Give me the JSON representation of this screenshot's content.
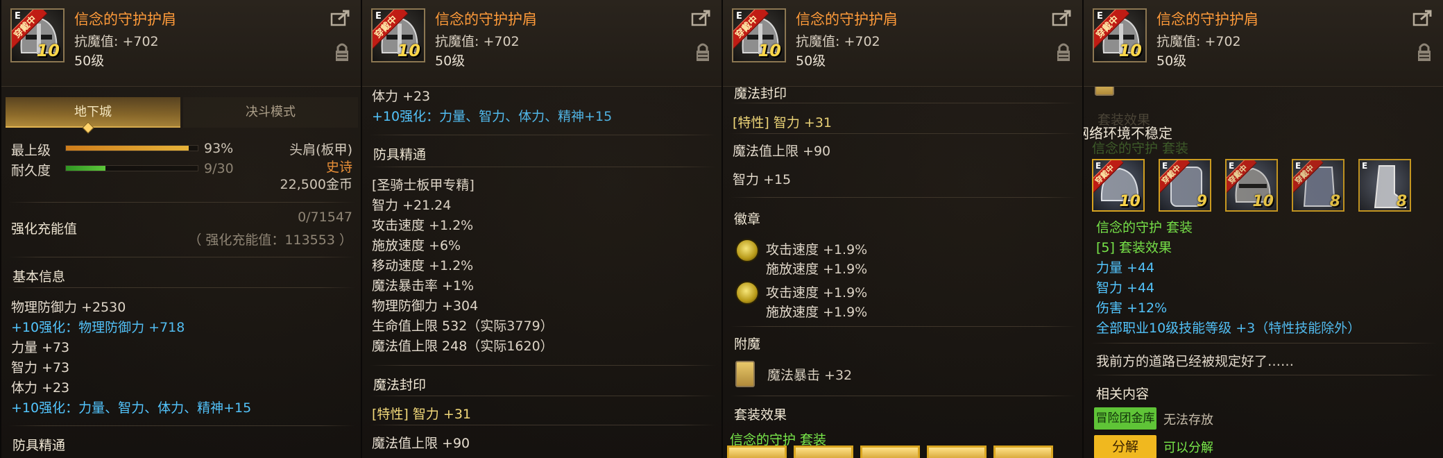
{
  "item": {
    "name": "信念的守护护肩",
    "stat": "抗魔值: +702",
    "level": "50级",
    "slot_tag": "E",
    "equipped_ribbon": "穿戴中",
    "reinforce": "10"
  },
  "tabs": [
    "地下城",
    "决斗模式"
  ],
  "grade": {
    "label": "最上级",
    "percent_text": "93%",
    "value": 0.93
  },
  "durability": {
    "label": "耐久度",
    "text": "9/30",
    "value": 0.3
  },
  "type": "头肩(板甲)",
  "rarity": "史诗",
  "price": "22,500金币",
  "charge": {
    "label": "强化充能值",
    "value": "0/71547",
    "note": "（ 强化充能值：113553 ）"
  },
  "basic": {
    "title": "基本信息",
    "lines": [
      "物理防御力 +2530",
      "+10强化：物理防御力 +718",
      "力量 +73",
      "智力 +73",
      "体力 +23",
      "+10强化：力量、智力、体力、精神+15"
    ]
  },
  "armor_mastery": {
    "title": "防具精通",
    "sub": "[圣骑士板甲专精]",
    "lines": [
      "智力 +21.24",
      "攻击速度 +1.2%",
      "施放速度 +6%",
      "移动速度 +1.2%",
      "魔法暴击率 +1%",
      "物理防御力 +304",
      "生命值上限 532（实际3779）",
      "魔法值上限 248（实际1620）"
    ]
  },
  "magic_seal": {
    "title": "魔法封印",
    "trait": "[特性] 智力 +31",
    "lines": [
      "魔法值上限 +90",
      "智力 +15"
    ]
  },
  "emblem": {
    "title": "徽章",
    "slots": [
      [
        "攻击速度 +1.9%",
        "施放速度 +1.9%"
      ],
      [
        "攻击速度 +1.9%",
        "施放速度 +1.9%"
      ]
    ]
  },
  "enchant": {
    "title": "附魔",
    "line": "魔法暴击 +32"
  },
  "set_effect": {
    "title": "套装效果",
    "name": "信念的守护 套装"
  },
  "panel4": {
    "faded_1": "套装效果",
    "network_warning": "网络环境不稳定",
    "faded_set": "信念的守护 套装",
    "set_items_lv": [
      "10",
      "9",
      "10",
      "8",
      "8"
    ],
    "set_name": "信念的守护 套装",
    "set_bonus_title": "[5] 套装效果",
    "set_bonus": [
      "力量 +44",
      "智力 +44",
      "伤害 +12%",
      "全部职业10级技能等级 +3（特性技能除外）"
    ],
    "flavor": "我前方的道路已经被规定好了……",
    "related": "相关内容",
    "storage_btn": "冒险团金库",
    "storage_text": "无法存放",
    "disassemble_btn": "分解",
    "disassemble_text": "可以分解"
  },
  "colors": {
    "name": "#ff9b3a",
    "reinforce": "#53c6ff",
    "set": "#79e84a",
    "epic": "#ff9b3a"
  }
}
